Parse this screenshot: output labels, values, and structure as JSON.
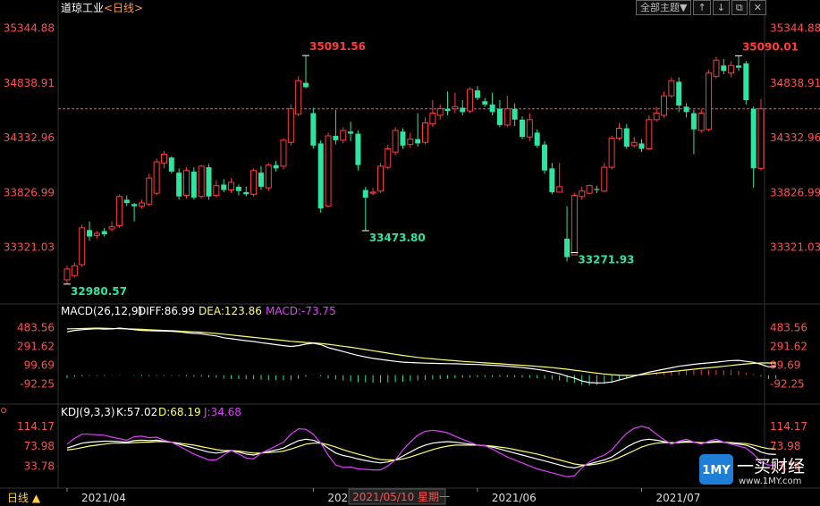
{
  "header": {
    "title": "道琼工业",
    "period": "<日线>"
  },
  "toolbar": {
    "theme_label": "全部主题▼",
    "icons": [
      "arrow-up-icon",
      "arrow-down-icon",
      "restore-icon",
      "close-icon"
    ]
  },
  "colors": {
    "up": "#ff3c3c",
    "down": "#2fe3a0",
    "price_axis": "#ff5050",
    "grid": "#333333",
    "ref_line": "#ff5050",
    "macd_yellow": "#ffff66",
    "kdj_magenta": "#e040fb"
  },
  "chart_data": [
    {
      "type": "candlestick",
      "title": "道琼工业",
      "y_ticks": [
        "35344.88",
        "34838.91",
        "34332.96",
        "33826.99",
        "33321.03"
      ],
      "ylim": [
        32830,
        35440
      ],
      "ref_line": 34600,
      "candles": [
        [
          33020,
          33120,
          32980,
          33150
        ],
        [
          33060,
          33150,
          33040,
          33180
        ],
        [
          33160,
          33500,
          33140,
          33530
        ],
        [
          33480,
          33420,
          33380,
          33560
        ],
        [
          33430,
          33450,
          33400,
          33470
        ],
        [
          33470,
          33440,
          33420,
          33500
        ],
        [
          33490,
          33510,
          33470,
          33560
        ],
        [
          33520,
          33790,
          33500,
          33810
        ],
        [
          33760,
          33730,
          33700,
          33800
        ],
        [
          33720,
          33700,
          33560,
          33730
        ],
        [
          33700,
          33730,
          33680,
          33760
        ],
        [
          33720,
          33960,
          33700,
          34000
        ],
        [
          33820,
          34110,
          33800,
          34140
        ],
        [
          34100,
          34180,
          34050,
          34210
        ],
        [
          34150,
          34020,
          34000,
          34160
        ],
        [
          34010,
          33790,
          33760,
          34050
        ],
        [
          33800,
          34030,
          33770,
          34060
        ],
        [
          34020,
          33780,
          33760,
          34060
        ],
        [
          33790,
          34070,
          33770,
          34080
        ],
        [
          34060,
          33790,
          33760,
          34090
        ],
        [
          33800,
          33890,
          33780,
          33940
        ],
        [
          33900,
          33850,
          33830,
          33950
        ],
        [
          33850,
          33920,
          33820,
          33960
        ],
        [
          33880,
          33840,
          33800,
          33900
        ],
        [
          33830,
          33810,
          33790,
          33880
        ],
        [
          33810,
          34030,
          33790,
          34050
        ],
        [
          34010,
          33880,
          33850,
          34070
        ],
        [
          33870,
          34080,
          33840,
          34100
        ],
        [
          34080,
          34050,
          34020,
          34120
        ],
        [
          34070,
          34310,
          34040,
          34330
        ],
        [
          34290,
          34600,
          34260,
          34640
        ],
        [
          34550,
          34860,
          34530,
          34900
        ],
        [
          34840,
          34800,
          34790,
          35092
        ],
        [
          34560,
          34260,
          34230,
          34610
        ],
        [
          34280,
          33680,
          33640,
          34310
        ],
        [
          33700,
          34350,
          33690,
          34380
        ],
        [
          34350,
          34310,
          34270,
          34590
        ],
        [
          34310,
          34400,
          34280,
          34430
        ],
        [
          34390,
          34370,
          34300,
          34480
        ],
        [
          34370,
          34080,
          34030,
          34400
        ],
        [
          33850,
          33780,
          33474,
          33880
        ],
        [
          33820,
          33830,
          33800,
          33870
        ],
        [
          33840,
          34070,
          33820,
          34100
        ],
        [
          34060,
          34230,
          34040,
          34270
        ],
        [
          34200,
          34400,
          34170,
          34430
        ],
        [
          34390,
          34260,
          34230,
          34420
        ],
        [
          34270,
          34320,
          34240,
          34380
        ],
        [
          34320,
          34280,
          34250,
          34560
        ],
        [
          34290,
          34470,
          34270,
          34520
        ],
        [
          34460,
          34560,
          34430,
          34680
        ],
        [
          34540,
          34600,
          34500,
          34640
        ],
        [
          34600,
          34580,
          34540,
          34760
        ],
        [
          34600,
          34620,
          34560,
          34750
        ],
        [
          34610,
          34570,
          34540,
          34680
        ],
        [
          34580,
          34780,
          34560,
          34800
        ],
        [
          34770,
          34700,
          34680,
          34810
        ],
        [
          34670,
          34640,
          34620,
          34700
        ],
        [
          34640,
          34570,
          34540,
          34750
        ],
        [
          34600,
          34450,
          34430,
          34680
        ],
        [
          34450,
          34600,
          34430,
          34720
        ],
        [
          34600,
          34500,
          34440,
          34650
        ],
        [
          34500,
          34340,
          34320,
          34530
        ],
        [
          34340,
          34500,
          34300,
          34560
        ],
        [
          34380,
          34260,
          34240,
          34410
        ],
        [
          34270,
          34030,
          34000,
          34300
        ],
        [
          34050,
          33830,
          33810,
          34100
        ],
        [
          33830,
          33880,
          33830,
          34100
        ],
        [
          33400,
          33230,
          33190,
          33700
        ],
        [
          33250,
          33800,
          33272,
          33820
        ],
        [
          33790,
          33840,
          33760,
          33880
        ],
        [
          33820,
          33890,
          33810,
          33900
        ],
        [
          33860,
          33850,
          33820,
          33890
        ],
        [
          33840,
          34060,
          33830,
          34100
        ],
        [
          34060,
          34330,
          34040,
          34350
        ],
        [
          34330,
          34420,
          34310,
          34470
        ],
        [
          34420,
          34250,
          34230,
          34460
        ],
        [
          34260,
          34290,
          34240,
          34340
        ],
        [
          34280,
          34230,
          34200,
          34320
        ],
        [
          34230,
          34500,
          34220,
          34540
        ],
        [
          34500,
          34560,
          34480,
          34620
        ],
        [
          34540,
          34720,
          34520,
          34760
        ],
        [
          34720,
          34860,
          34700,
          34890
        ],
        [
          34850,
          34630,
          34570,
          34890
        ],
        [
          34620,
          34570,
          34520,
          34650
        ],
        [
          34560,
          34410,
          34180,
          34590
        ],
        [
          34400,
          34560,
          34380,
          34600
        ],
        [
          34410,
          34930,
          34390,
          34960
        ],
        [
          34900,
          35050,
          34880,
          35080
        ],
        [
          35000,
          34950,
          34920,
          35060
        ],
        [
          34930,
          35000,
          34890,
          35040
        ],
        [
          35000,
          34980,
          34950,
          35090
        ],
        [
          35020,
          34680,
          34640,
          35040
        ],
        [
          34600,
          34050,
          33870,
          34620
        ],
        [
          34050,
          34600,
          34030,
          34690
        ]
      ],
      "annotations": [
        {
          "label": "35091.56",
          "index": 32,
          "value": 35092,
          "pos": "above"
        },
        {
          "label": "33473.80",
          "index": 40,
          "value": 33474,
          "pos": "below"
        },
        {
          "label": "33271.93",
          "index": 68,
          "value": 33272,
          "pos": "below"
        },
        {
          "label": "35090.01",
          "index": 90,
          "value": 35090,
          "pos": "above"
        },
        {
          "label": "32980.57",
          "index": 0,
          "value": 32980,
          "pos": "below"
        }
      ]
    },
    {
      "type": "macd",
      "legend": {
        "name": "MACD(26,12,9)",
        "diff": "DIFF:86.99",
        "dea": "DEA:123.86",
        "macd": "MACD:-73.75"
      },
      "y_ticks": [
        "483.56",
        "291.62",
        "99.69",
        "-92.25"
      ],
      "ylim": [
        -240,
        560
      ],
      "diff": [
        440,
        455,
        462,
        468,
        472,
        468,
        470,
        478,
        470,
        462,
        455,
        452,
        450,
        448,
        445,
        440,
        432,
        425,
        420,
        408,
        398,
        380,
        370,
        360,
        350,
        342,
        330,
        320,
        310,
        300,
        292,
        300,
        315,
        325,
        310,
        280,
        260,
        240,
        220,
        200,
        185,
        170,
        160,
        150,
        140,
        132,
        128,
        125,
        122,
        120,
        118,
        116,
        115,
        113,
        110,
        108,
        105,
        100,
        96,
        90,
        84,
        76,
        68,
        58,
        46,
        30,
        14,
        -10,
        -30,
        -60,
        -75,
        -80,
        -78,
        -70,
        -50,
        -30,
        -10,
        10,
        30,
        45,
        60,
        75,
        90,
        100,
        110,
        118,
        125,
        132,
        140,
        148,
        150,
        140,
        130,
        110,
        85,
        87
      ],
      "dea": [
        470,
        472,
        474,
        476,
        478,
        476,
        474,
        472,
        470,
        468,
        465,
        462,
        458,
        455,
        452,
        448,
        444,
        440,
        436,
        430,
        424,
        416,
        408,
        400,
        392,
        384,
        376,
        368,
        360,
        352,
        344,
        338,
        332,
        328,
        322,
        314,
        304,
        294,
        284,
        272,
        260,
        248,
        236,
        224,
        212,
        200,
        190,
        180,
        172,
        165,
        158,
        152,
        146,
        140,
        135,
        130,
        125,
        120,
        115,
        110,
        105,
        100,
        95,
        89,
        83,
        76,
        68,
        60,
        50,
        40,
        30,
        20,
        12,
        5,
        0,
        -3,
        -2,
        5,
        12,
        20,
        28,
        36,
        44,
        52,
        60,
        68,
        75,
        82,
        90,
        98,
        106,
        114,
        120,
        124,
        124,
        124
      ],
      "hist": [
        -30,
        -17,
        -12,
        -8,
        -6,
        -8,
        -4,
        6,
        0,
        -6,
        -10,
        -10,
        -8,
        -7,
        -7,
        -8,
        -12,
        -15,
        -16,
        -22,
        -26,
        -36,
        -38,
        -40,
        -42,
        -42,
        -46,
        -48,
        -50,
        -52,
        -52,
        -38,
        -17,
        -3,
        -12,
        -34,
        -44,
        -54,
        -64,
        -72,
        -75,
        -78,
        -76,
        -74,
        -72,
        -68,
        -62,
        -55,
        -50,
        -45,
        -40,
        -36,
        -31,
        -27,
        -25,
        -22,
        -20,
        -20,
        -19,
        -20,
        -21,
        -24,
        -27,
        -31,
        -37,
        -46,
        -54,
        -70,
        -80,
        -100,
        -105,
        -100,
        -90,
        -75,
        -50,
        -27,
        -8,
        5,
        18,
        25,
        32,
        39,
        46,
        48,
        50,
        50,
        50,
        50,
        50,
        50,
        44,
        26,
        10,
        -14,
        -39,
        -37
      ]
    },
    {
      "type": "kdj",
      "legend": {
        "name": "KDJ(9,3,3)",
        "k": "K:57.02",
        "d": "D:68.19",
        "j": "J:34.68"
      },
      "y_ticks": [
        "114.17",
        "73.98",
        "33.78"
      ],
      "ylim": [
        0,
        130
      ],
      "k": [
        70,
        75,
        80,
        82,
        83,
        84,
        84,
        83,
        82,
        85,
        86,
        85,
        86,
        84,
        82,
        78,
        74,
        70,
        66,
        62,
        60,
        62,
        65,
        62,
        58,
        56,
        60,
        63,
        66,
        70,
        78,
        85,
        88,
        86,
        80,
        70,
        60,
        55,
        52,
        48,
        45,
        42,
        40,
        42,
        46,
        54,
        62,
        70,
        76,
        80,
        82,
        83,
        82,
        80,
        78,
        76,
        75,
        72,
        68,
        64,
        60,
        56,
        52,
        48,
        44,
        40,
        36,
        32,
        30,
        34,
        38,
        42,
        46,
        52,
        62,
        72,
        80,
        86,
        88,
        86,
        83,
        80,
        82,
        84,
        82,
        80,
        82,
        84,
        82,
        80,
        78,
        76,
        70,
        62,
        58,
        57
      ],
      "d": [
        66,
        68,
        71,
        74,
        76,
        78,
        80,
        80,
        80,
        81,
        82,
        82,
        83,
        83,
        82,
        80,
        78,
        76,
        73,
        70,
        67,
        65,
        65,
        64,
        62,
        60,
        60,
        61,
        62,
        64,
        68,
        73,
        78,
        80,
        80,
        77,
        72,
        67,
        62,
        58,
        54,
        50,
        47,
        46,
        46,
        48,
        52,
        57,
        62,
        67,
        71,
        74,
        76,
        76,
        76,
        76,
        75,
        74,
        72,
        70,
        67,
        64,
        61,
        58,
        54,
        50,
        46,
        42,
        38,
        36,
        36,
        38,
        41,
        45,
        51,
        58,
        65,
        72,
        77,
        80,
        81,
        81,
        81,
        82,
        82,
        81,
        81,
        82,
        82,
        81,
        80,
        79,
        76,
        72,
        69,
        68
      ],
      "j": [
        78,
        90,
        98,
        98,
        97,
        96,
        92,
        89,
        86,
        93,
        94,
        91,
        92,
        86,
        82,
        74,
        66,
        58,
        52,
        46,
        46,
        56,
        65,
        58,
        50,
        48,
        60,
        67,
        74,
        82,
        98,
        109,
        108,
        98,
        80,
        56,
        36,
        31,
        32,
        28,
        27,
        26,
        26,
        34,
        46,
        66,
        82,
        96,
        104,
        106,
        104,
        101,
        94,
        88,
        82,
        76,
        75,
        68,
        60,
        52,
        46,
        40,
        34,
        28,
        24,
        20,
        16,
        12,
        14,
        30,
        42,
        50,
        56,
        66,
        84,
        100,
        110,
        114,
        110,
        98,
        87,
        78,
        84,
        88,
        82,
        78,
        84,
        88,
        82,
        78,
        74,
        70,
        58,
        42,
        36,
        35
      ]
    },
    {
      "type": "x-axis",
      "period_label": "日线",
      "ticks": [
        "2021/04",
        "2021/05",
        "2021/06",
        "2021/07"
      ],
      "tick_index": [
        0,
        33,
        55,
        77
      ],
      "crosshair_label": "2021/05/10 星期一",
      "crosshair_index": 38
    }
  ],
  "watermark": {
    "logo_text": "1MY",
    "brand": "一买财经",
    "url": "www.1MY.com"
  }
}
